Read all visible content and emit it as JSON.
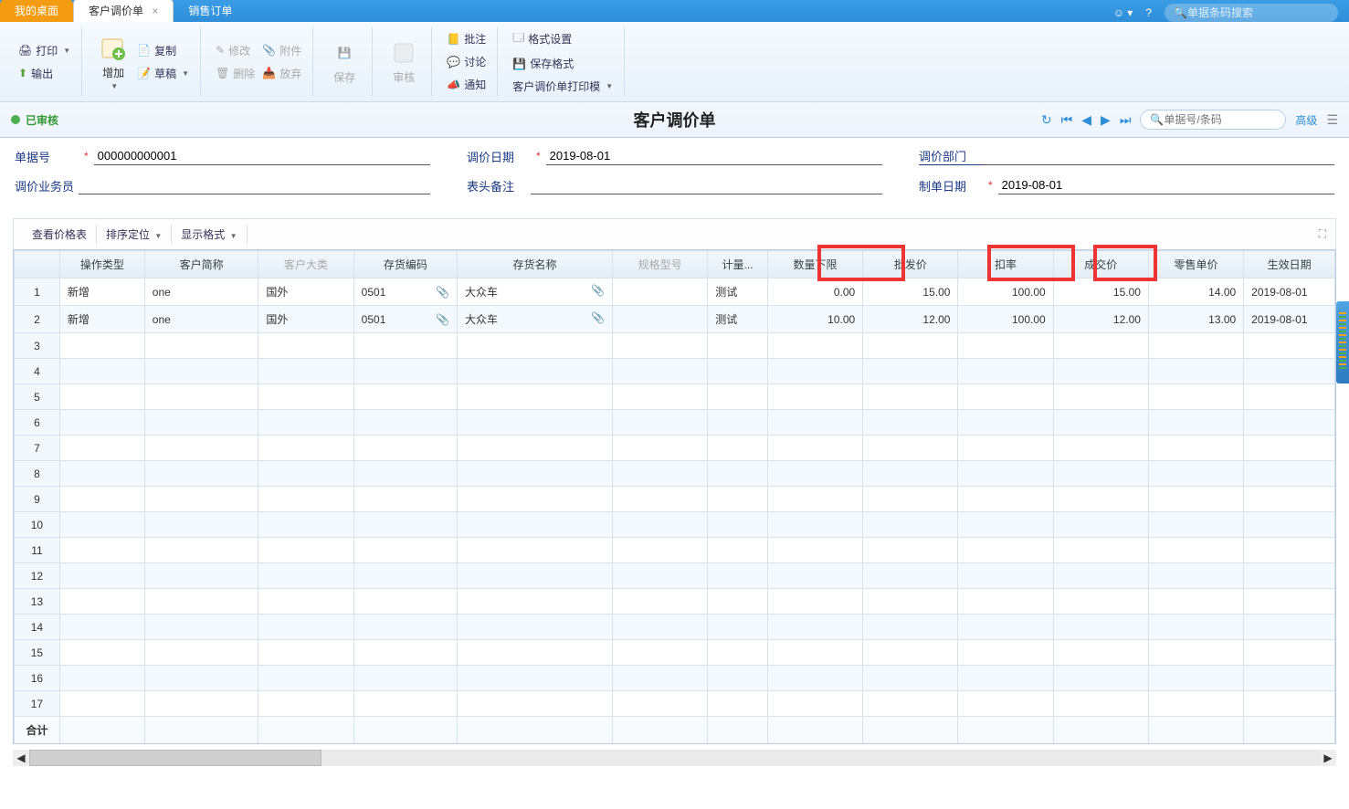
{
  "tabs": {
    "desktop": "我的桌面",
    "current": "客户调价单",
    "sales": "销售订单"
  },
  "topSearchPlaceholder": "单据条码搜索",
  "ribbon": {
    "print": "打印",
    "export": "输出",
    "add": "增加",
    "copy": "复制",
    "draft": "草稿",
    "modify": "修改",
    "delete": "删除",
    "attach": "附件",
    "abandon": "放弃",
    "save": "保存",
    "audit": "审核",
    "remark": "批注",
    "discuss": "讨论",
    "notify": "通知",
    "formatSet": "格式设置",
    "saveFormat": "保存格式",
    "printTpl": "客户调价单打印模"
  },
  "status": {
    "text": "已审核"
  },
  "pageTitle": "客户调价单",
  "navSearchPlaceholder": "单据号/条码",
  "advLabel": "高级",
  "form": {
    "docNoLabel": "单据号",
    "docNo": "000000000001",
    "dateLabel": "调价日期",
    "date": "2019-08-01",
    "deptLabel": "调价部门",
    "dept": "",
    "salesLabel": "调价业务员",
    "sales": "",
    "memoLabel": "表头备注",
    "memo": "",
    "createDateLabel": "制单日期",
    "createDate": "2019-08-01"
  },
  "gridToolbar": {
    "viewPrice": "查看价格表",
    "sort": "排序定位",
    "display": "显示格式"
  },
  "columns": [
    "操作类型",
    "客户简称",
    "客户大类",
    "存货编码",
    "存货名称",
    "规格型号",
    "计量...",
    "数量下限",
    "批发价",
    "扣率",
    "成交价",
    "零售单价",
    "生效日期"
  ],
  "mutedCols": [
    2,
    5
  ],
  "rows": [
    {
      "op": "新增",
      "cust": "one",
      "cat": "国外",
      "code": "0501",
      "name": "大众车",
      "spec": "",
      "unit": "测试",
      "minQty": "0.00",
      "wholesale": "15.00",
      "rate": "100.00",
      "deal": "15.00",
      "retail": "14.00",
      "eff": "2019-08-01"
    },
    {
      "op": "新增",
      "cust": "one",
      "cat": "国外",
      "code": "0501",
      "name": "大众车",
      "spec": "",
      "unit": "测试",
      "minQty": "10.00",
      "wholesale": "12.00",
      "rate": "100.00",
      "deal": "12.00",
      "retail": "13.00",
      "eff": "2019-08-01"
    }
  ],
  "totalLabel": "合计",
  "emptyRows": 15
}
